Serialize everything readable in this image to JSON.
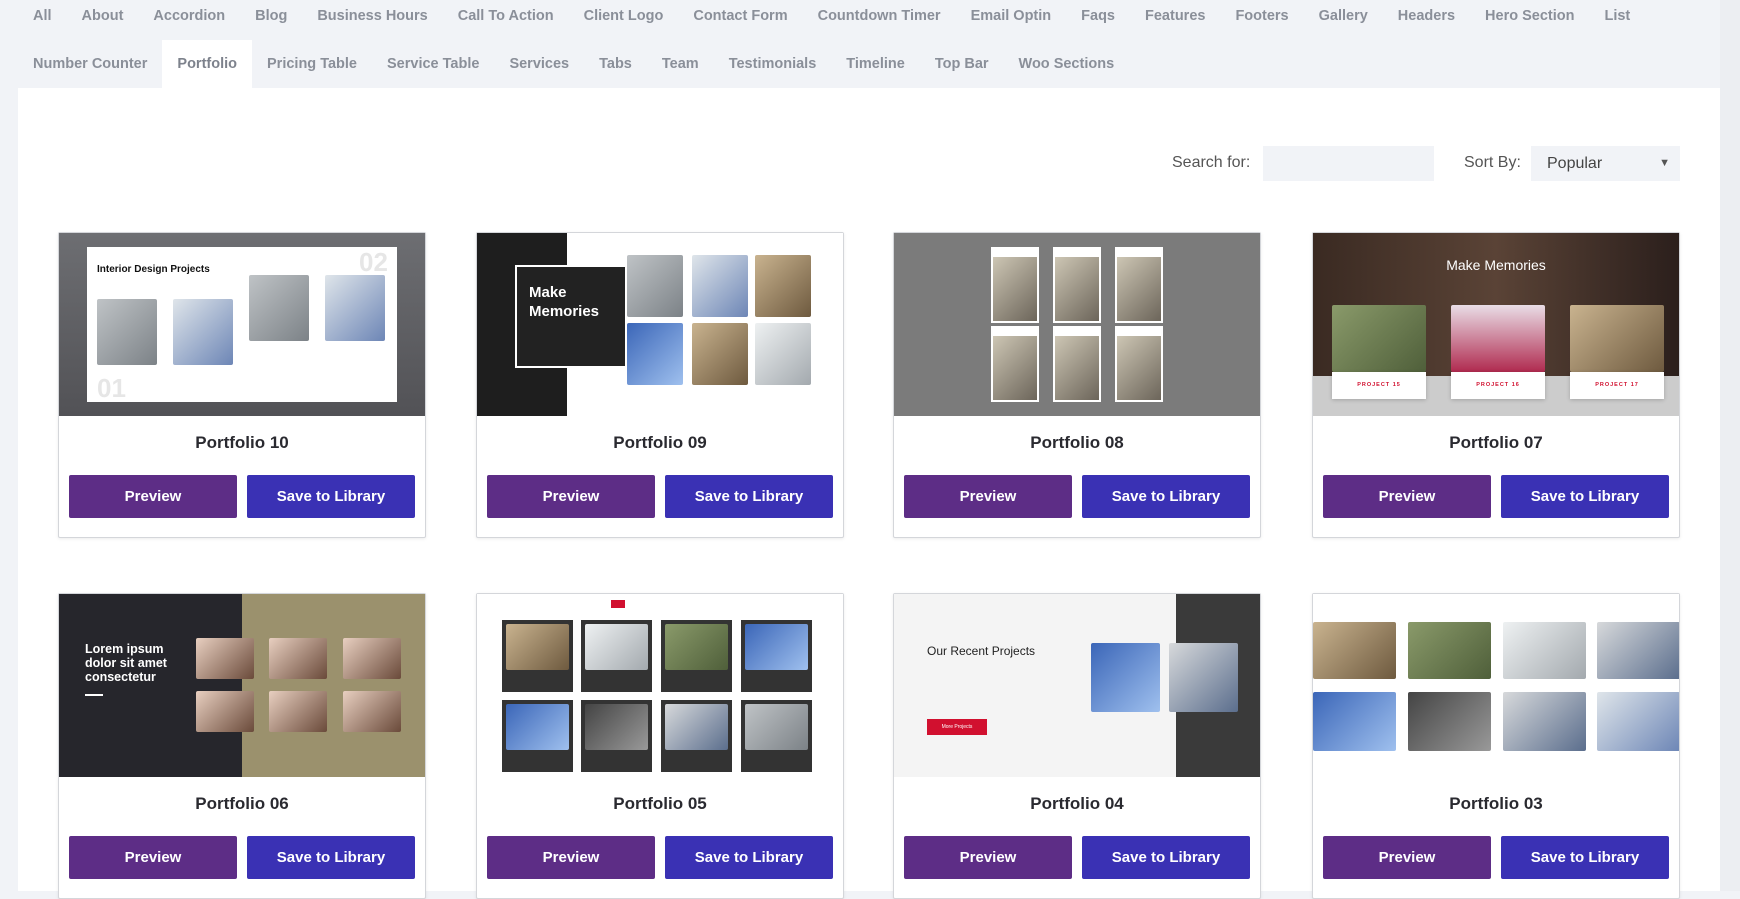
{
  "tabs_row1": [
    "All",
    "About",
    "Accordion",
    "Blog",
    "Business Hours",
    "Call To Action",
    "Client Logo",
    "Contact Form",
    "Countdown Timer",
    "Email Optin",
    "Faqs",
    "Features",
    "Footers",
    "Gallery",
    "Headers",
    "Hero Section",
    "List"
  ],
  "tabs_row2": [
    "Number Counter",
    "Portfolio",
    "Pricing Table",
    "Service Table",
    "Services",
    "Tabs",
    "Team",
    "Testimonials",
    "Timeline",
    "Top Bar",
    "Woo Sections"
  ],
  "active_tab": "Portfolio",
  "search": {
    "label": "Search for:",
    "value": "",
    "placeholder": ""
  },
  "sort": {
    "label": "Sort By:",
    "value": "Popular",
    "arrow_icon": "caret-down"
  },
  "colors": {
    "preview": "#5d2d86",
    "save": "#3a31b4",
    "bg": "#f1f3f7"
  },
  "cards": [
    {
      "title": "Portfolio 10",
      "thumb": "interior",
      "thumb_text": {
        "heading": "Interior Design Projects",
        "num1": "01",
        "num2": "02"
      },
      "preview": "Preview",
      "save": "Save to Library"
    },
    {
      "title": "Portfolio 09",
      "thumb": "memories-split",
      "thumb_text": {
        "heading": "Make Memories"
      },
      "preview": "Preview",
      "save": "Save to Library"
    },
    {
      "title": "Portfolio 08",
      "thumb": "statues",
      "thumb_text": {},
      "preview": "Preview",
      "save": "Save to Library"
    },
    {
      "title": "Portfolio 07",
      "thumb": "food",
      "thumb_text": {
        "heading": "Make Memories",
        "p1": "PROJECT 15",
        "p2": "PROJECT 16",
        "p3": "PROJECT 17"
      },
      "preview": "Preview",
      "save": "Save to Library"
    },
    {
      "title": "Portfolio 06",
      "thumb": "faces",
      "thumb_text": {
        "heading": "Lorem ipsum dolor sit amet consectetur"
      },
      "preview": "Preview",
      "save": "Save to Library"
    },
    {
      "title": "Portfolio 05",
      "thumb": "dark-grid",
      "thumb_text": {},
      "preview": "Preview",
      "save": "Save to Library"
    },
    {
      "title": "Portfolio 04",
      "thumb": "recent",
      "thumb_text": {
        "heading": "Our Recent Projects",
        "button": "More Projects"
      },
      "preview": "Preview",
      "save": "Save to Library"
    },
    {
      "title": "Portfolio 03",
      "thumb": "photo-grid",
      "thumb_text": {},
      "preview": "Preview",
      "save": "Save to Library"
    }
  ]
}
